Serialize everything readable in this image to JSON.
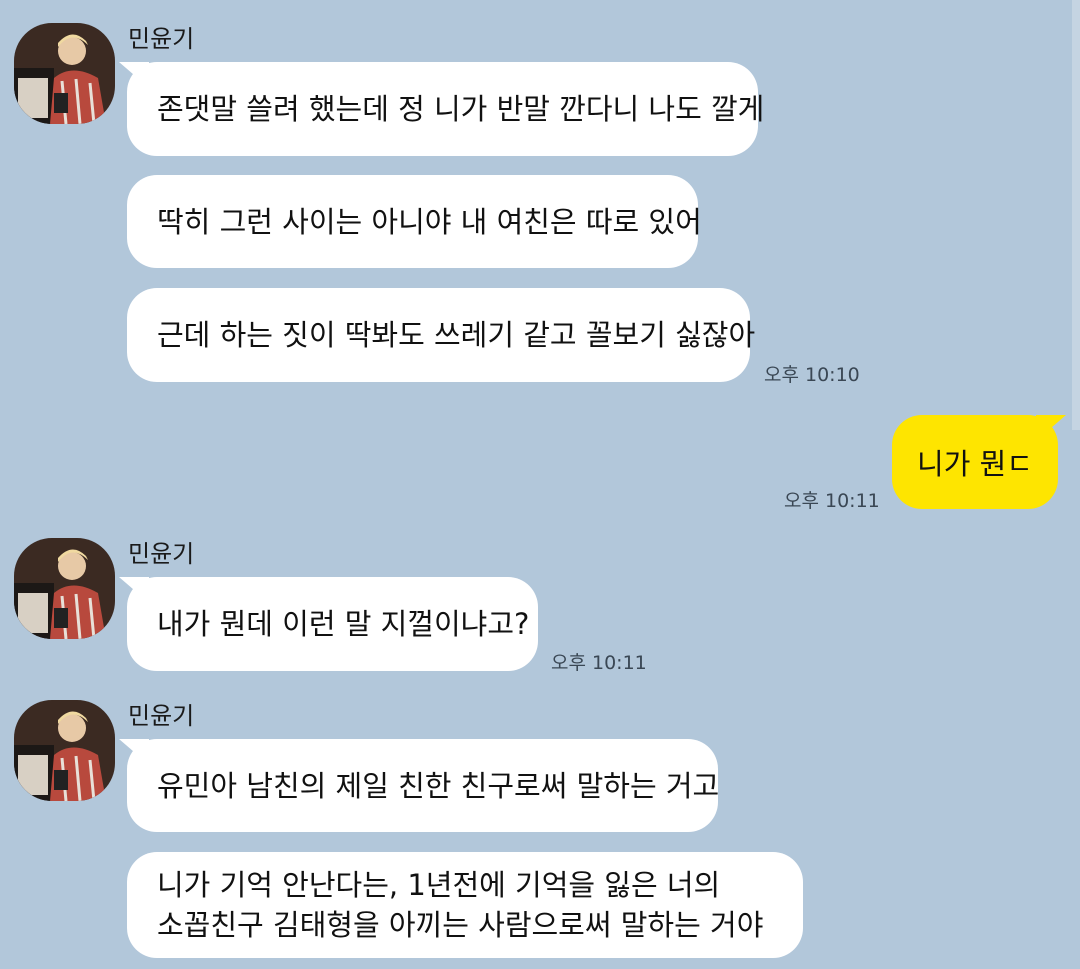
{
  "chat": {
    "messages": [
      {
        "sender": "민윤기",
        "bubbles": [
          "존댓말 쓸려 했는데 정 니가 반말 깐다니 나도 깔게",
          "딱히 그런 사이는 아니야 내 여친은 따로 있어",
          "근데 하는 짓이 딱봐도 쓰레기 같고 꼴보기 싫잖아"
        ],
        "time": "오후 10:10"
      },
      {
        "mine": "니가 뭔ㄷ",
        "time": "오후 10:11"
      },
      {
        "sender": "민윤기",
        "bubbles": [
          "내가 뭔데 이런 말 지껄이냐고?"
        ],
        "time": "오후 10:11"
      },
      {
        "sender": "민윤기",
        "bubbles": [
          "유민아 남친의 제일 친한 친구로써 말하는 거고"
        ],
        "multi_lines": [
          "니가 기억 안난다는, 1년전에 기억을 잃은 너의",
          "소꼽친구 김태형을 아끼는 사람으로써 말하는 거야"
        ]
      }
    ]
  },
  "colors": {
    "background": "#b2c7da",
    "incoming_bubble": "#ffffff",
    "outgoing_bubble": "#fee500"
  }
}
